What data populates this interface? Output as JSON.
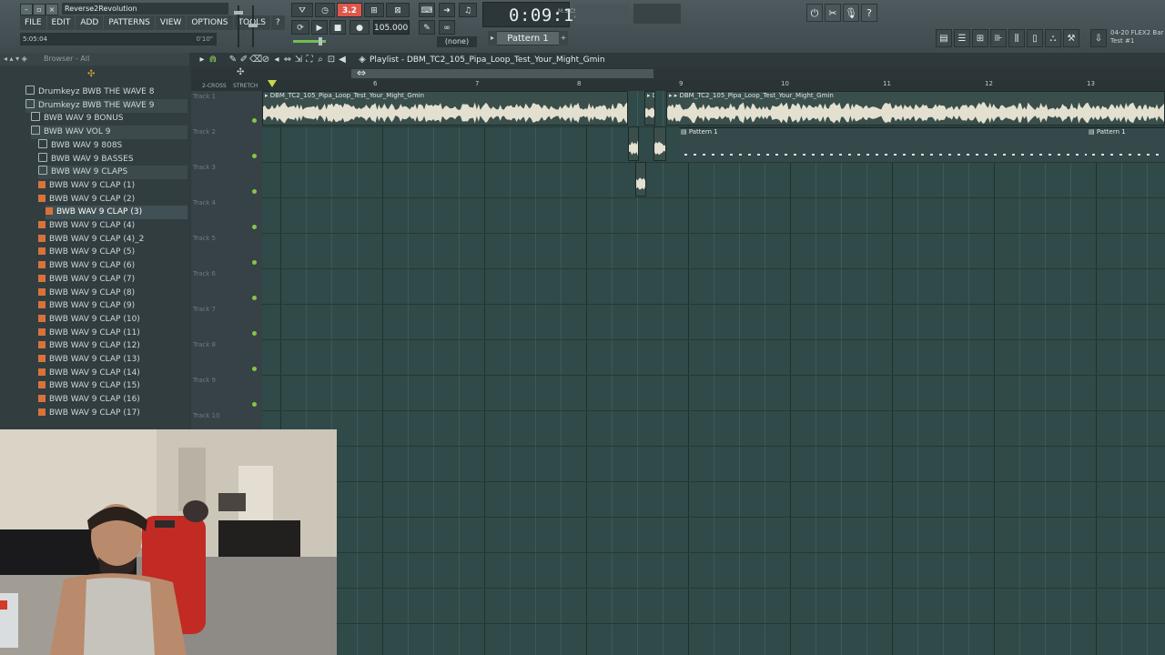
{
  "window": {
    "title": "Reverse2Revolution"
  },
  "menu": [
    "FILE",
    "EDIT",
    "ADD",
    "PATTERNS",
    "VIEW",
    "OPTIONS",
    "TOOLS",
    "?"
  ],
  "hint": {
    "left": "5:05:04",
    "right": "0'10\""
  },
  "transport": {
    "countdown": "3.2",
    "tempo": "105.000",
    "time": "0:09:14",
    "time_sub": "14",
    "time_unit": "M:S:CS",
    "snap": "(none)",
    "pattern": "Pattern 1"
  },
  "news": {
    "line1": "04-20 FLEX2 Bar",
    "line2": "Test #1"
  },
  "browser": {
    "header": "Browser - All",
    "items": [
      {
        "label": "Drumkeyz BWB THE WAVE 8",
        "type": "folder",
        "indent": 0
      },
      {
        "label": "Drumkeyz BWB THE WAVE 9",
        "type": "folder",
        "indent": 0
      },
      {
        "label": "BWB WAV 9 BONUS",
        "type": "folder",
        "indent": 1
      },
      {
        "label": "BWB WAV VOL 9",
        "type": "folder",
        "indent": 1
      },
      {
        "label": "BWB WAV 9 808S",
        "type": "folder",
        "indent": 2
      },
      {
        "label": "BWB WAV 9 BASSES",
        "type": "folder",
        "indent": 2
      },
      {
        "label": "BWB WAV 9 CLAPS",
        "type": "folder",
        "indent": 2
      },
      {
        "label": "BWB WAV 9 CLAP (1)",
        "type": "file",
        "indent": 2
      },
      {
        "label": "BWB WAV 9 CLAP (2)",
        "type": "file",
        "indent": 2
      },
      {
        "label": "BWB WAV 9 CLAP (3)",
        "type": "file",
        "indent": 3
      },
      {
        "label": "BWB WAV 9 CLAP (4)",
        "type": "file",
        "indent": 2
      },
      {
        "label": "BWB WAV 9 CLAP (4)_2",
        "type": "file",
        "indent": 2
      },
      {
        "label": "BWB WAV 9 CLAP (5)",
        "type": "file",
        "indent": 2
      },
      {
        "label": "BWB WAV 9 CLAP (6)",
        "type": "file",
        "indent": 2
      },
      {
        "label": "BWB WAV 9 CLAP (7)",
        "type": "file",
        "indent": 2
      },
      {
        "label": "BWB WAV 9 CLAP (8)",
        "type": "file",
        "indent": 2
      },
      {
        "label": "BWB WAV 9 CLAP (9)",
        "type": "file",
        "indent": 2
      },
      {
        "label": "BWB WAV 9 CLAP (10)",
        "type": "file",
        "indent": 2
      },
      {
        "label": "BWB WAV 9 CLAP (11)",
        "type": "file",
        "indent": 2
      },
      {
        "label": "BWB WAV 9 CLAP (12)",
        "type": "file",
        "indent": 2
      },
      {
        "label": "BWB WAV 9 CLAP (13)",
        "type": "file",
        "indent": 2
      },
      {
        "label": "BWB WAV 9 CLAP (14)",
        "type": "file",
        "indent": 2
      },
      {
        "label": "BWB WAV 9 CLAP (15)",
        "type": "file",
        "indent": 2
      },
      {
        "label": "BWB WAV 9 CLAP (16)",
        "type": "file",
        "indent": 2
      },
      {
        "label": "BWB WAV 9 CLAP (17)",
        "type": "file",
        "indent": 2
      }
    ],
    "selected": "BWB WAV 9 CLAP (3)"
  },
  "playlist": {
    "title": "Playlist - DBM_TC2_105_Pipa_Loop_Test_Your_Might_Gmin",
    "ruler_marks": [
      "6",
      "7",
      "8",
      "9",
      "10",
      "11",
      "12",
      "13"
    ],
    "ruler_left": {
      "a": "2-CROSS",
      "b": "STRETCH"
    },
    "tracks": [
      "Track 1",
      "Track 2",
      "Track 3",
      "Track 4",
      "Track 5",
      "Track 6",
      "Track 7",
      "Track 8",
      "Track 9",
      "Track 10"
    ],
    "audio_clip_name": "DBM_TC2_105_Pipa_Loop_Test_Your_Might_Gmin",
    "pattern_clip_name": "Pattern 1"
  },
  "colors": {
    "accent_red": "#e0574a",
    "led_green": "#88c34a",
    "waveform": "#e4e0cf",
    "playhead": "#c9d94a"
  },
  "icons": [
    "metronome-icon",
    "play-icon",
    "stop-icon",
    "record-icon",
    "undo-icon",
    "mic-icon",
    "help-icon",
    "folder-icon",
    "audio-file-icon"
  ]
}
